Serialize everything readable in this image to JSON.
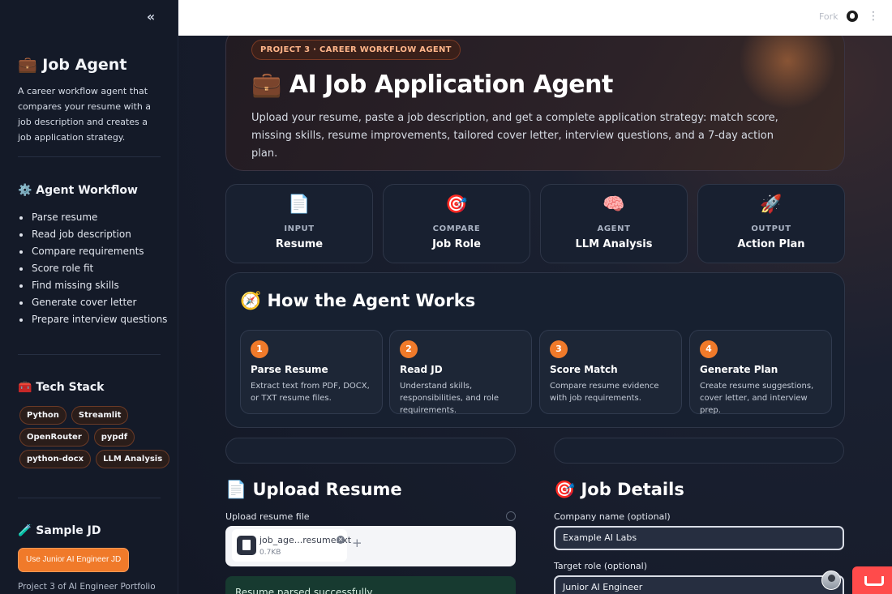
{
  "sidebar": {
    "collapse_icon": "«",
    "title": "💼 Job Agent",
    "description": "A career workflow agent that compares your resume with a job description and creates a job application strategy.",
    "workflow_title": "⚙️ Agent Workflow",
    "workflow_items": [
      "Parse resume",
      "Read job description",
      "Compare requirements",
      "Score role fit",
      "Find missing skills",
      "Generate cover letter",
      "Prepare interview questions"
    ],
    "tech_title": "🧰 Tech Stack",
    "tech_rows": [
      [
        "Python",
        "Streamlit"
      ],
      [
        "OpenRouter",
        "pypdf"
      ],
      [
        "python-docx",
        "LLM Analysis"
      ]
    ],
    "sample_title": "🧪 Sample JD",
    "sample_button": "Use Junior AI Engineer JD",
    "footer": "Project 3 of AI Engineer Portfolio"
  },
  "topbar": {
    "fork_label": "Fork",
    "kebab": "⋮"
  },
  "hero": {
    "badge": "PROJECT 3 · CAREER WORKFLOW AGENT",
    "title": "💼 AI Job Application Agent",
    "subtitle": "Upload your resume, paste a job description, and get a complete application strategy: match score, missing skills, resume improvements, tailored cover letter, interview questions, and a 7-day action plan."
  },
  "stats": [
    {
      "icon": "📄",
      "label": "INPUT",
      "value": "Resume"
    },
    {
      "icon": "🎯",
      "label": "COMPARE",
      "value": "Job Role"
    },
    {
      "icon": "🧠",
      "label": "AGENT",
      "value": "LLM Analysis"
    },
    {
      "icon": "🚀",
      "label": "OUTPUT",
      "value": "Action Plan"
    }
  ],
  "how": {
    "title": "🧭 How the Agent Works",
    "steps": [
      {
        "num": "1",
        "title": "Parse Resume",
        "desc": "Extract text from PDF, DOCX, or TXT resume files."
      },
      {
        "num": "2",
        "title": "Read JD",
        "desc": "Understand skills, responsibilities, and role requirements."
      },
      {
        "num": "3",
        "title": "Score Match",
        "desc": "Compare resume evidence with job requirements."
      },
      {
        "num": "4",
        "title": "Generate Plan",
        "desc": "Create resume suggestions, cover letter, and interview prep."
      }
    ]
  },
  "upload": {
    "title": "📄 Upload Resume",
    "label": "Upload resume file",
    "file_name": "job_age...resume.txt",
    "file_size": "0.7KB",
    "remove_icon": "×",
    "add_icon": "+",
    "success": "Resume parsed successfully"
  },
  "job": {
    "title": "🎯 Job Details",
    "company_label": "Company name (optional)",
    "company_value": "Example AI Labs",
    "role_label": "Target role (optional)",
    "role_value": "Junior AI Engineer"
  }
}
